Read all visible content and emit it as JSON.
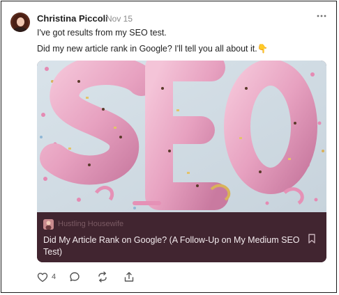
{
  "post": {
    "author": "Christina Piccoli",
    "date": "Nov 15",
    "lines": [
      "I've got results from my SEO test.",
      "Did my new article rank in Google? I'll tell you all about it.👇"
    ],
    "more_icon": "more-horizontal-icon"
  },
  "card": {
    "publication": "Hustling Housewife",
    "title": "Did My Article Rank on Google? (A Follow-Up on My Medium SEO Test)",
    "image_text": "SEO",
    "bookmark_icon": "bookmark-icon"
  },
  "actions": {
    "like_count": "4",
    "icons": [
      "heart-icon",
      "comment-icon",
      "restack-icon",
      "share-icon"
    ]
  },
  "colors": {
    "card_background": "#412530",
    "balloon_pink": "#e9a6c4",
    "date_gray": "#8a8a8a"
  }
}
